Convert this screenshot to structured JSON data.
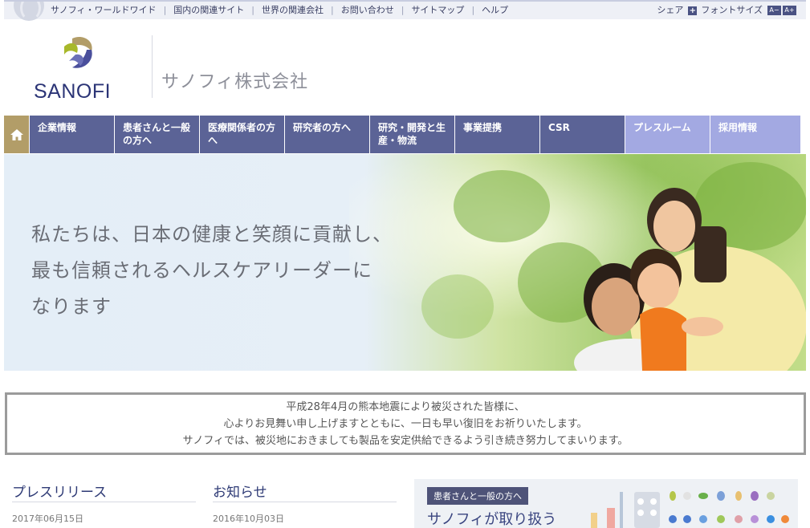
{
  "util": {
    "links": [
      "サノフィ・ワールドワイド",
      "国内の関連サイト",
      "世界の関連会社",
      "お問い合わせ",
      "サイトマップ",
      "ヘルプ"
    ],
    "share": "シェア",
    "font_size": "フォントサイズ",
    "font_small": "A−",
    "font_large": "A+"
  },
  "header": {
    "logo_text": "SANOFI",
    "company": "サノフィ株式会社"
  },
  "nav": {
    "items": [
      "企業情報",
      "患者さんと一般の方へ",
      "医療関係者の方へ",
      "研究者の方へ",
      "研究・開発と生産・物流",
      "事業提携",
      "CSR",
      "プレスルーム",
      "採用情報"
    ]
  },
  "hero": {
    "lines": [
      "私たちは、日本の健康と笑顔に貢献し、",
      "最も信頼されるヘルスケアリーダーに",
      "なります"
    ]
  },
  "notice": {
    "lines": [
      "平成28年4月の熊本地震により被災された皆様に、",
      "心よりお見舞い申し上げますとともに、一日も早い復旧をお祈りいたします。",
      "サノフィでは、被災地におきましても製品を安定供給できるよう引き続き努力してまいります。"
    ]
  },
  "press": {
    "title": "プレスリリース",
    "date": "2017年06月15日"
  },
  "news": {
    "title": "お知らせ",
    "date": "2016年10月03日"
  },
  "side": {
    "badge": "患者さんと一般の方へ",
    "title": "サノフィが取り扱う"
  },
  "colors": {
    "nav": "#5b6396",
    "nav_light": "#a3a9e2",
    "home": "#b29d68",
    "brand": "#2b3476"
  }
}
